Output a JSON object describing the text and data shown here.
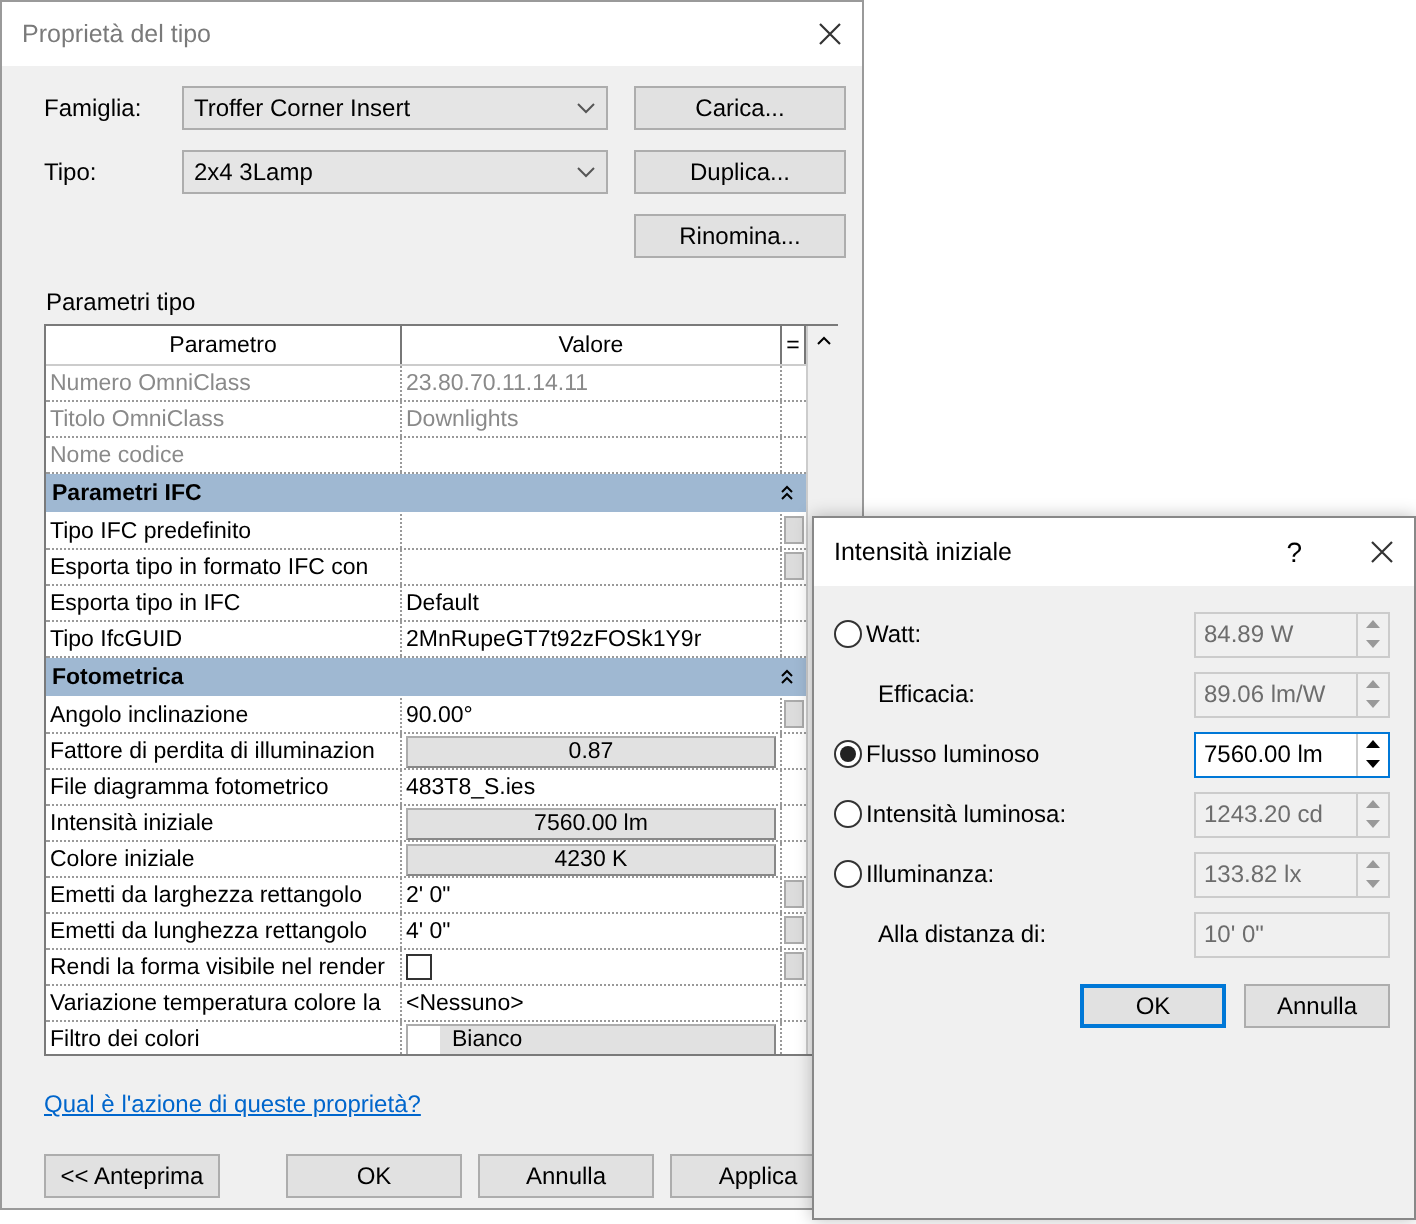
{
  "window": {
    "title": "Proprietà del tipo"
  },
  "family": {
    "label": "Famiglia:",
    "value": "Troffer Corner Insert"
  },
  "type": {
    "label": "Tipo:",
    "value": "2x4 3Lamp"
  },
  "side_buttons": [
    "Carica...",
    "Duplica...",
    "Rinomina..."
  ],
  "params_label": "Parametri tipo",
  "table": {
    "columns": [
      "Parametro",
      "Valore",
      "="
    ],
    "rows": [
      {
        "kind": "text",
        "name": "Numero OmniClass",
        "value": "23.80.70.11.14.11",
        "disabled": true,
        "side_button": false
      },
      {
        "kind": "text",
        "name": "Titolo OmniClass",
        "value": "Downlights",
        "disabled": true,
        "side_button": false
      },
      {
        "kind": "text",
        "name": "Nome codice",
        "disabled": true,
        "side_button": false
      },
      {
        "kind": "group",
        "name": "Parametri IFC",
        "expanded": true
      },
      {
        "kind": "text",
        "name": "Tipo IFC predefinito",
        "disabled": false,
        "side_button": true
      },
      {
        "kind": "text",
        "name": "Esporta tipo in formato IFC con",
        "disabled": false,
        "side_button": true
      },
      {
        "kind": "text",
        "name": "Esporta tipo in IFC",
        "value": "Default",
        "disabled": false,
        "side_button": false
      },
      {
        "kind": "text",
        "name": "Tipo IfcGUID",
        "value": "2MnRupeGT7t92zFOSk1Y9r",
        "disabled": false,
        "side_button": false
      },
      {
        "kind": "group",
        "name": "Fotometrica",
        "expanded": true
      },
      {
        "kind": "text",
        "name": "Angolo inclinazione",
        "value": "90.00°",
        "disabled": false,
        "side_button": true
      },
      {
        "kind": "button",
        "name": "Fattore di perdita di illuminazion",
        "value": "0.87",
        "disabled": false,
        "side_button": false
      },
      {
        "kind": "text",
        "name": "File diagramma fotometrico",
        "value": "483T8_S.ies",
        "disabled": false,
        "side_button": false
      },
      {
        "kind": "button",
        "name": "Intensità iniziale",
        "value": "7560.00 lm",
        "disabled": false,
        "side_button": false
      },
      {
        "kind": "button",
        "name": "Colore iniziale",
        "value": "4230 K",
        "disabled": false,
        "side_button": false
      },
      {
        "kind": "text",
        "name": "Emetti da larghezza rettangolo",
        "value": "2'  0\"",
        "disabled": false,
        "side_button": true
      },
      {
        "kind": "text",
        "name": "Emetti da lunghezza rettangolo",
        "value": "4'  0\"",
        "disabled": false,
        "side_button": true
      },
      {
        "kind": "check",
        "name": "Rendi la forma visibile nel render",
        "checked": false,
        "disabled": false,
        "side_button": true
      },
      {
        "kind": "text",
        "name": "Variazione temperatura colore la",
        "value": "<Nessuno>",
        "disabled": false,
        "side_button": false
      },
      {
        "kind": "swatch",
        "name": "Filtro dei colori",
        "value": "Bianco",
        "disabled": false,
        "side_button": false
      }
    ]
  },
  "help_link": "Qual è l'azione di queste proprietà?",
  "footer_buttons": [
    "<< Anteprima",
    "OK",
    "Annulla",
    "Applica"
  ],
  "popup": {
    "title": "Intensità iniziale",
    "help": "?",
    "options": [
      {
        "kind": "radio",
        "label": "Watt:",
        "selected": false,
        "value": "84.89 W",
        "disabled": true,
        "spinner": true
      },
      {
        "kind": "sub",
        "label": "Efficacia:",
        "value": "89.06 lm/W",
        "disabled": true,
        "spinner": true
      },
      {
        "kind": "radio",
        "label": "Flusso luminoso",
        "selected": true,
        "value": "7560.00 lm",
        "disabled": false,
        "spinner": true
      },
      {
        "kind": "radio",
        "label": "Intensità luminosa:",
        "selected": false,
        "value": "1243.20 cd",
        "disabled": true,
        "spinner": true
      },
      {
        "kind": "radio",
        "label": "Illuminanza:",
        "selected": false,
        "value": "133.82 lx",
        "disabled": true,
        "spinner": true
      },
      {
        "kind": "sub",
        "label": "Alla distanza di:",
        "value": "10'  0\"",
        "disabled": true,
        "spinner": false
      }
    ],
    "buttons": [
      "OK",
      "Annulla"
    ]
  }
}
